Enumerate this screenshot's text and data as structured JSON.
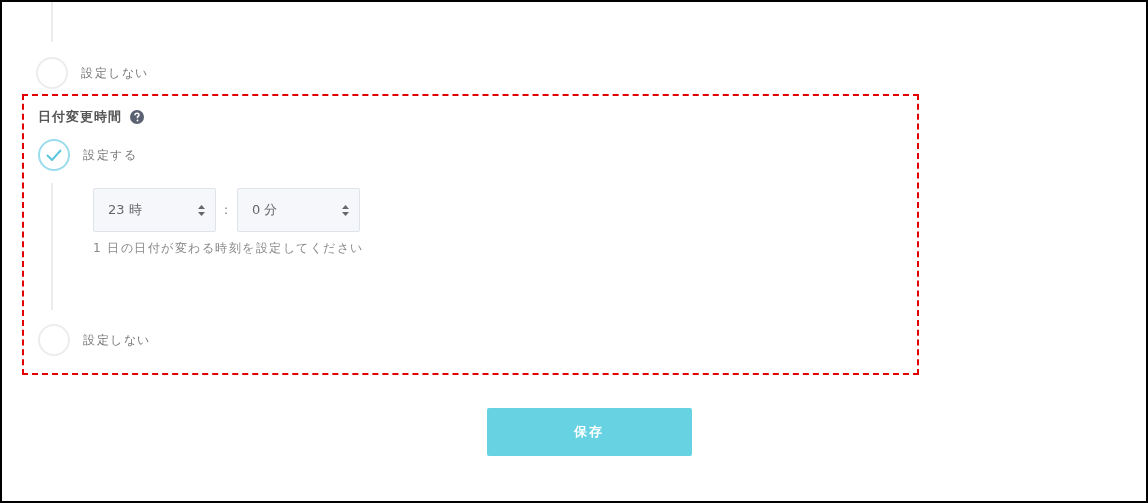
{
  "previous_section": {
    "options": [
      {
        "label": "設定しない",
        "selected": false
      }
    ]
  },
  "date_change_section": {
    "title": "日付変更時間",
    "highlighted": true,
    "options": [
      {
        "label": "設定する",
        "selected": true
      },
      {
        "label": "設定しない",
        "selected": false
      }
    ],
    "hour_select": {
      "value": "23 時"
    },
    "separator": ":",
    "minute_select": {
      "value": "0 分"
    },
    "hint": "1 日の日付が変わる時刻を設定してください"
  },
  "save_button": {
    "label": "保存"
  }
}
